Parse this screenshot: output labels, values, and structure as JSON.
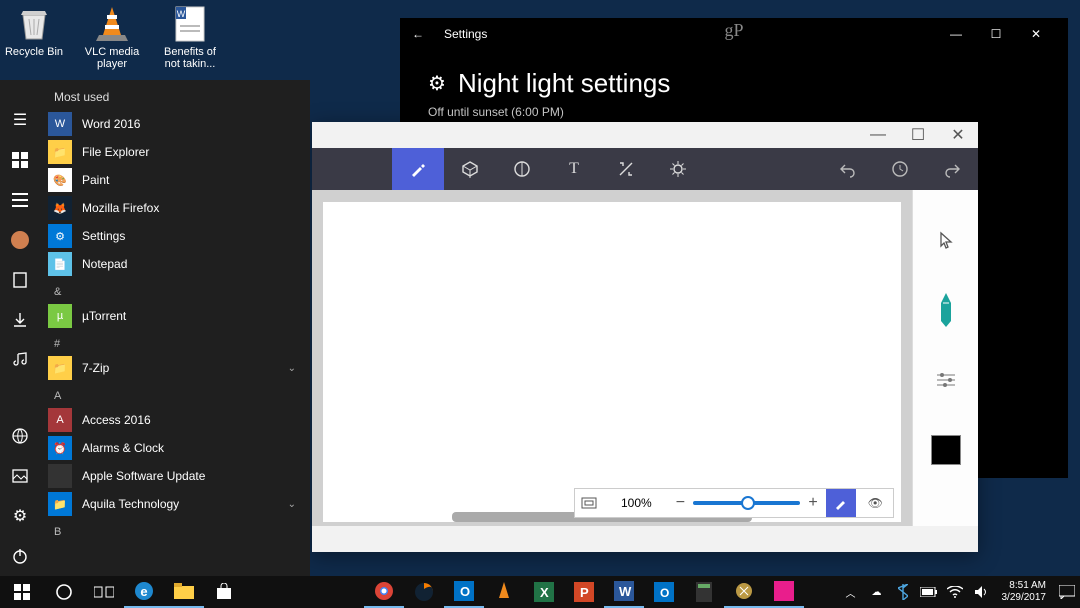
{
  "desktop": {
    "icons": [
      {
        "label": "Recycle Bin",
        "name": "recycle-bin"
      },
      {
        "label": "VLC media player",
        "name": "vlc"
      },
      {
        "label": "Benefits of not takin...",
        "name": "doc-benefits"
      }
    ]
  },
  "start_menu": {
    "most_used_header": "Most used",
    "most_used": [
      {
        "label": "Word 2016",
        "name": "word",
        "ic_bg": "#2b579a",
        "ic_txt": "W"
      },
      {
        "label": "File Explorer",
        "name": "file-explorer",
        "ic_bg": "#ffcf48",
        "ic_txt": "📁"
      },
      {
        "label": "Paint",
        "name": "paint",
        "ic_bg": "#ffffff",
        "ic_txt": "🎨"
      },
      {
        "label": "Mozilla Firefox",
        "name": "firefox",
        "ic_bg": "#123",
        "ic_txt": "🦊"
      },
      {
        "label": "Settings",
        "name": "settings",
        "ic_bg": "#0078d7",
        "ic_txt": "⚙"
      },
      {
        "label": "Notepad",
        "name": "notepad",
        "ic_bg": "#5ec2e8",
        "ic_txt": "📄"
      }
    ],
    "amp_header": "&",
    "amp_items": [
      {
        "label": "µTorrent",
        "name": "utorrent",
        "ic_bg": "#7ac943",
        "ic_txt": "µ"
      }
    ],
    "hash_header": "#",
    "hash_items": [
      {
        "label": "7-Zip",
        "name": "7zip",
        "ic_bg": "#ffcf48",
        "ic_txt": "📁",
        "expand": true
      }
    ],
    "a_header": "A",
    "a_items": [
      {
        "label": "Access 2016",
        "name": "access",
        "ic_bg": "#a4373a",
        "ic_txt": "A"
      },
      {
        "label": "Alarms & Clock",
        "name": "alarms",
        "ic_bg": "#0078d7",
        "ic_txt": "⏰"
      },
      {
        "label": "Apple Software Update",
        "name": "apple-su",
        "ic_bg": "#333",
        "ic_txt": ""
      },
      {
        "label": "Aquila Technology",
        "name": "aquila",
        "ic_bg": "#0078d7",
        "ic_txt": "📁",
        "expand": true
      }
    ],
    "b_header": "B"
  },
  "settings": {
    "titlebar": "Settings",
    "heading": "Night light settings",
    "subtitle": "Off until sunset (6:00 PM)",
    "watermark": "gP"
  },
  "paint": {
    "zoom_label": "100%",
    "tools": [
      "brush",
      "3d",
      "sticker",
      "text",
      "crop",
      "effects"
    ],
    "color": "#000000"
  },
  "taskbar": {
    "time": "8:51 AM",
    "date": "3/29/2017"
  }
}
